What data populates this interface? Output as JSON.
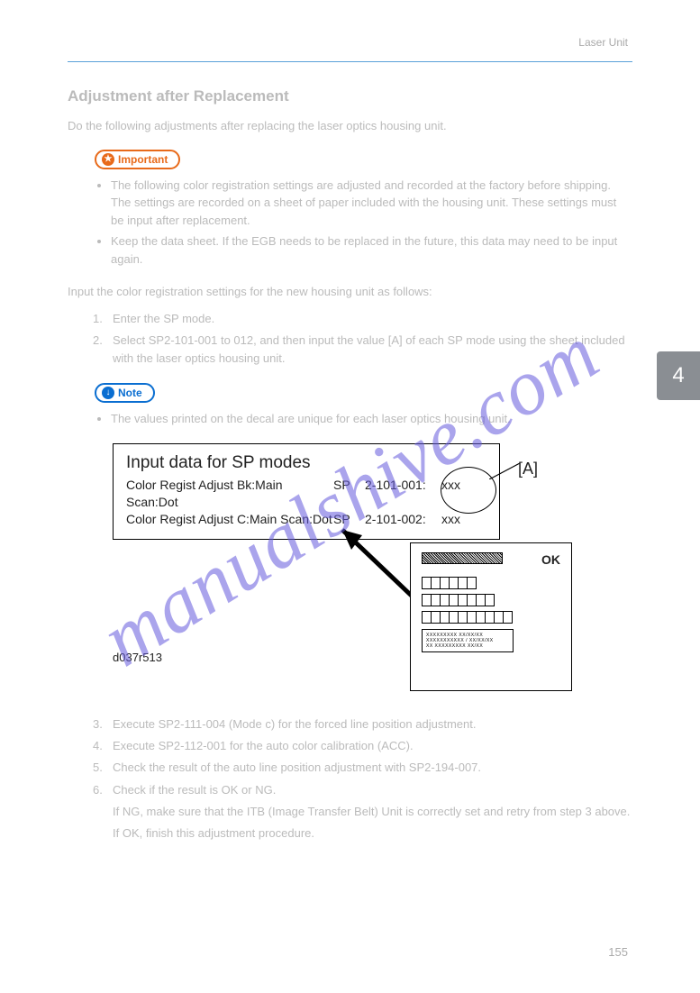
{
  "header": {
    "right": "Laser Unit"
  },
  "section_title": "Adjustment after Replacement",
  "intro": "Do the following adjustments after replacing the laser optics housing unit.",
  "important": {
    "label": "Important",
    "bullets": [
      "The following color registration settings are adjusted and recorded at the factory before shipping. The settings are recorded on a sheet of paper included with the housing unit. These settings must be input after replacement.",
      "Keep the data sheet. If the EGB needs to be replaced in the future, this data may need to be input again."
    ]
  },
  "steps_title": "Input the color registration settings for the new housing unit as follows:",
  "steps": [
    {
      "n": "1.",
      "text": "Enter the SP mode."
    },
    {
      "n": "2.",
      "text": "Select SP2-101-001 to 012, and then input the value [A] of each SP mode using the sheet included with the laser optics housing unit."
    }
  ],
  "note": {
    "label": "Note",
    "bullets": [
      "The values printed on the decal are unique for each laser optics housing unit."
    ]
  },
  "figure": {
    "box_title": "Input data for SP modes",
    "rows": [
      {
        "left": "Color Regist Adjust Bk:Main Scan:Dot",
        "mid": "SP",
        "code": "2-101-001:",
        "val": "xxx"
      },
      {
        "left": "Color Regist Adjust C:Main Scan:Dot",
        "mid": "SP",
        "code": "2-101-002:",
        "val": "xxx"
      }
    ],
    "callout": "[A]",
    "panel_ok": "OK",
    "id": "d037r513"
  },
  "post_steps": [
    {
      "n": "3.",
      "text": "Execute SP2-111-004 (Mode c) for the forced line position adjustment."
    },
    {
      "n": "4.",
      "text": "Execute SP2-112-001 for the auto color calibration (ACC)."
    },
    {
      "n": "5.",
      "text": "Check the result of the auto line position adjustment with SP2-194-007."
    },
    {
      "n": "6.",
      "text": "Check if the result is OK or NG."
    },
    {
      "n": "",
      "text": "If NG, make sure that the ITB (Image Transfer Belt) Unit is correctly set and retry from step 3 above."
    },
    {
      "n": "",
      "text": "If OK, finish this adjustment procedure."
    }
  ],
  "side_tab": "4",
  "page_number": "155",
  "watermark": "manualshive.com"
}
